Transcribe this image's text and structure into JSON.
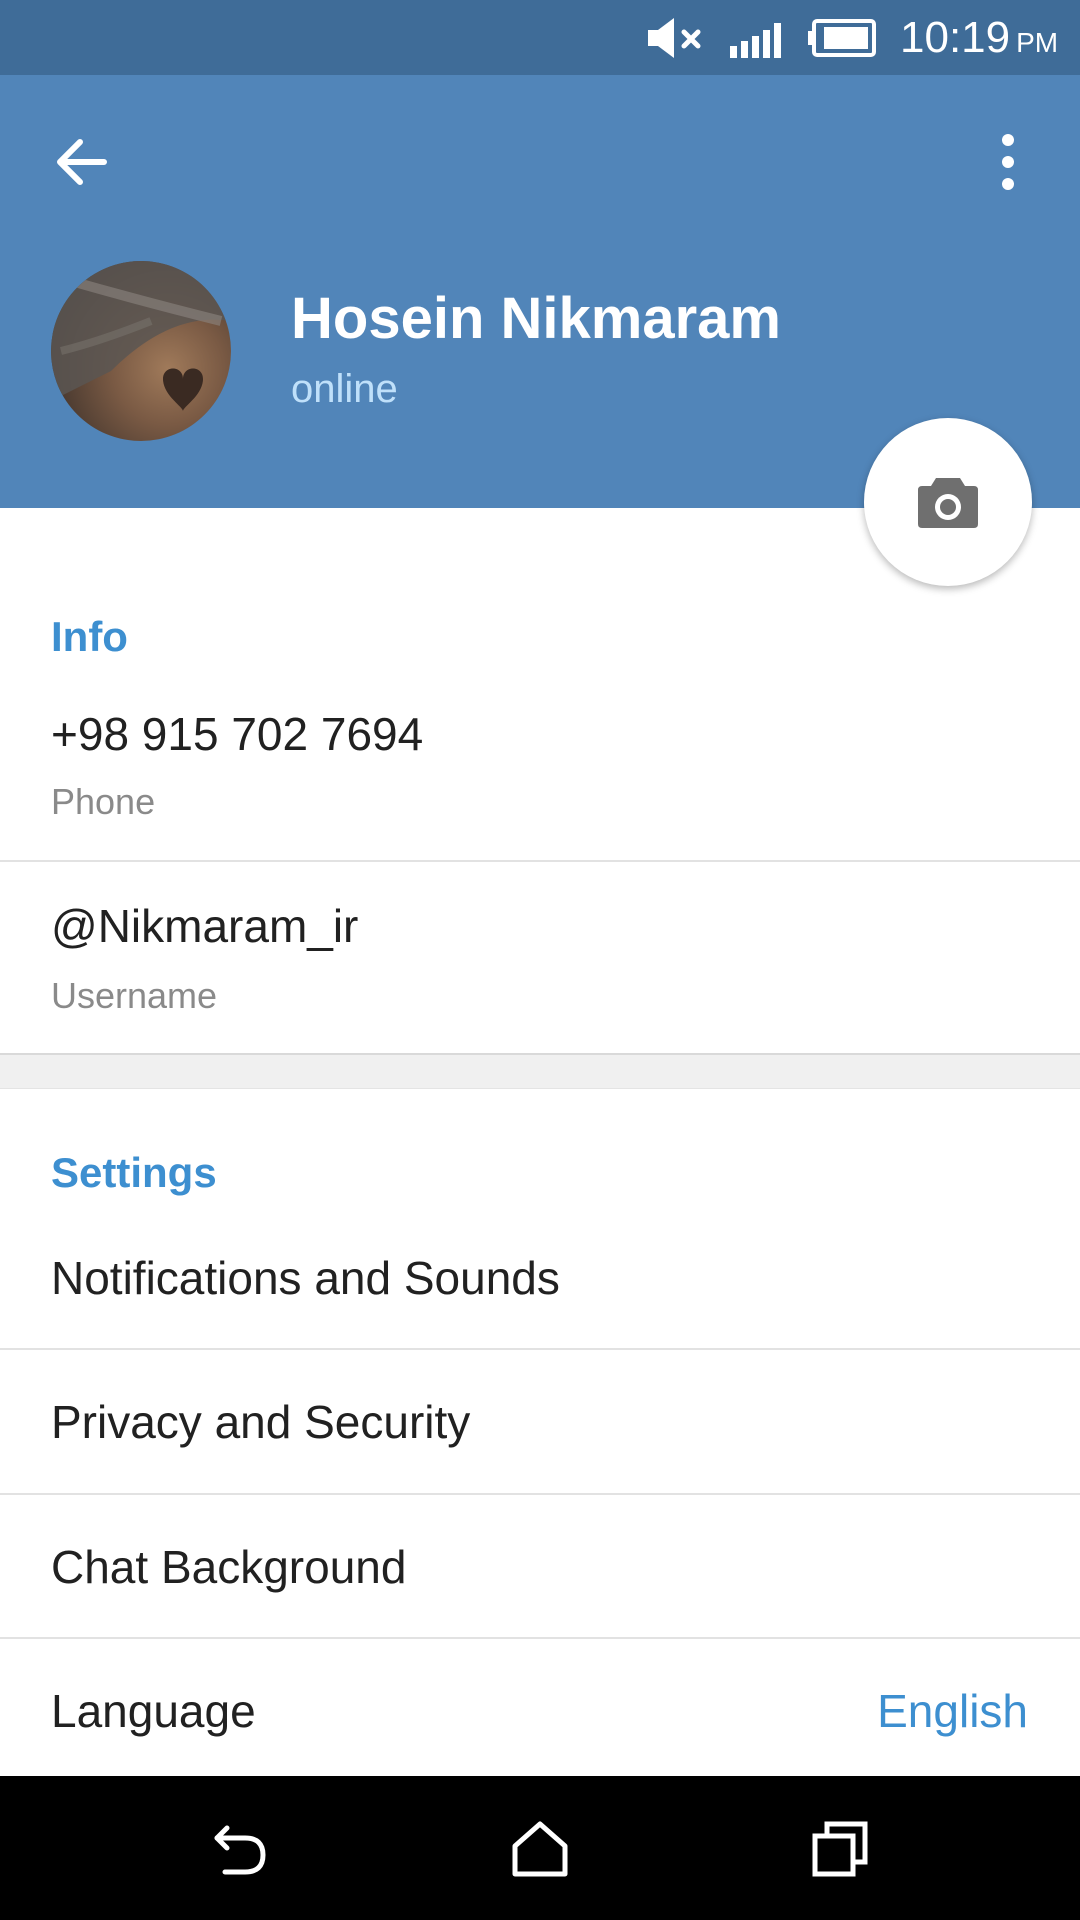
{
  "status_bar": {
    "time": "10:19",
    "ampm": "PM",
    "icons": [
      "volume-muted-icon",
      "signal-icon",
      "battery-icon"
    ]
  },
  "header": {
    "back_icon": "arrow-left-icon",
    "more_icon": "more-vertical-icon",
    "name": "Hosein Nikmaram",
    "status": "online",
    "camera_icon": "camera-icon"
  },
  "info": {
    "title": "Info",
    "phone_value": "+98 915 702 7694",
    "phone_label": "Phone",
    "username_value": "@Nikmaram_ir",
    "username_label": "Username"
  },
  "settings": {
    "title": "Settings",
    "items": [
      {
        "label": "Notifications and Sounds"
      },
      {
        "label": "Privacy and Security"
      },
      {
        "label": "Chat Background"
      },
      {
        "label": "Language",
        "value": "English"
      }
    ]
  },
  "nav_bar": {
    "icons": [
      "back-icon",
      "home-icon",
      "recents-icon"
    ]
  },
  "colors": {
    "status_bar": "#3f6c98",
    "header": "#5185b9",
    "accent": "#3d8fd0",
    "online": "#bfe0fa"
  }
}
